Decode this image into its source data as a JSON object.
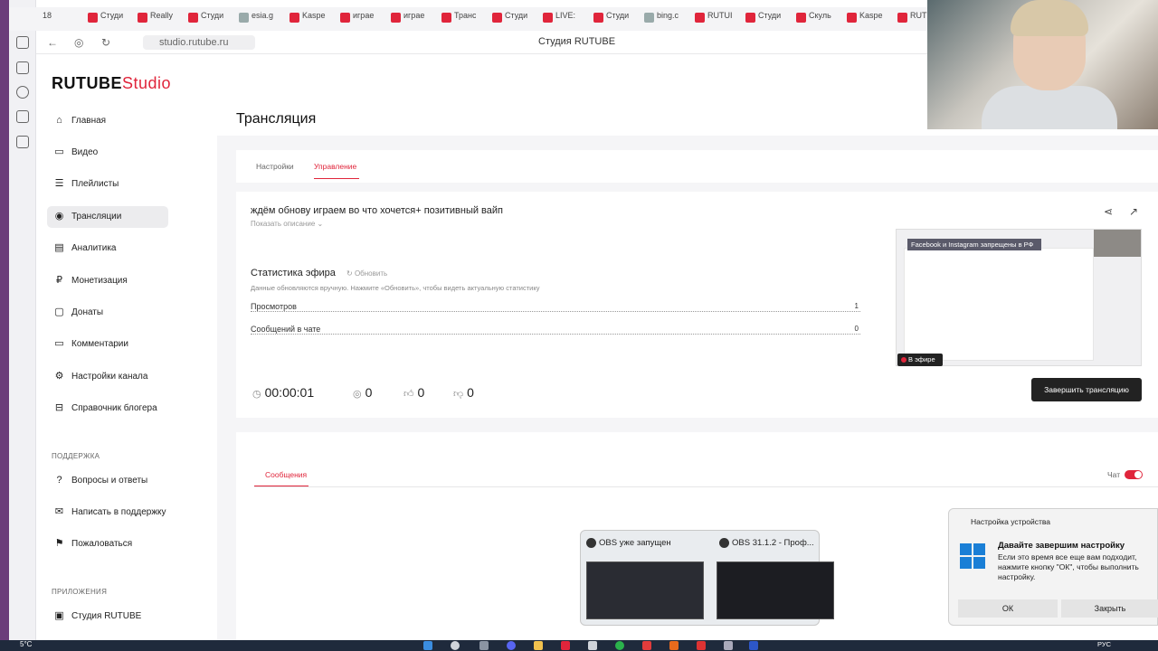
{
  "browser": {
    "tabs": [
      "Студи",
      "Really",
      "Студи",
      "esia.g",
      "Kaspe",
      "играе",
      "играе",
      "Транс",
      "Студи",
      "LIVE:",
      "Студи",
      "bing.c",
      "RUTUI",
      "Студи",
      "Скуль",
      "Kaspe",
      "RUTI"
    ],
    "tab_count_badge": "18",
    "url": "studio.rutube.ru",
    "page_title": "Студия RUTUBE"
  },
  "logo": {
    "brand": "RUTUBE",
    "studio": "Studio"
  },
  "sidebar": {
    "items": [
      {
        "label": "Главная",
        "icon": "home-icon"
      },
      {
        "label": "Видео",
        "icon": "video-icon"
      },
      {
        "label": "Плейлисты",
        "icon": "playlist-icon"
      },
      {
        "label": "Трансляции",
        "icon": "broadcast-icon"
      },
      {
        "label": "Аналитика",
        "icon": "analytics-icon"
      },
      {
        "label": "Монетизация",
        "icon": "monetization-icon"
      },
      {
        "label": "Донаты",
        "icon": "donations-icon"
      },
      {
        "label": "Комментарии",
        "icon": "comments-icon"
      },
      {
        "label": "Настройки канала",
        "icon": "gear-icon"
      },
      {
        "label": "Справочник блогера",
        "icon": "book-icon"
      }
    ],
    "support_header": "ПОДДЕРЖКА",
    "support_items": [
      {
        "label": "Вопросы и ответы",
        "icon": "question-icon"
      },
      {
        "label": "Написать в поддержку",
        "icon": "mail-icon"
      },
      {
        "label": "Пожаловаться",
        "icon": "flag-icon"
      }
    ],
    "apps_header": "ПРИЛОЖЕНИЯ",
    "apps_items": [
      {
        "label": "Студия RUTUBE",
        "icon": "studio-app-icon"
      }
    ]
  },
  "main": {
    "title": "Трансляция",
    "tabs": [
      {
        "label": "Настройки"
      },
      {
        "label": "Управление"
      }
    ],
    "stream_title": "ждём обнову играем во что хочется+ позитивный вайп",
    "show_description": "Показать описание",
    "stats": {
      "title": "Статистика эфира",
      "refresh": "Обновить",
      "note": "Данные обновляются вручную. Нажмите «Обновить», чтобы видеть актуальную статистику",
      "rows": [
        {
          "label": "Просмотров",
          "value": "1"
        },
        {
          "label": "Сообщений в чате",
          "value": "0"
        }
      ]
    },
    "metrics": {
      "duration": "00:00:01",
      "viewers": "0",
      "likes": "0",
      "dislikes": "0"
    },
    "preview": {
      "banner": "Facebook и Instagram запрещены в РФ",
      "live_badge": "В эфире"
    },
    "end_stream_button": "Завершить трансляцию",
    "messages_tab": "Сообщения",
    "chat_label": "Чат",
    "chat_enabled": true
  },
  "obs_popup": {
    "left_title": "OBS уже запущен",
    "right_title": "OBS 31.1.2 - Проф..."
  },
  "notification": {
    "header": "Настройка устройства",
    "title": "Давайте завершим настройку",
    "body": "Если это время все еще вам подходит, нажмите кнопку \"ОК\", чтобы выполнить настройку.",
    "ok_button": "ОК",
    "close_button": "Закрыть"
  },
  "taskbar": {
    "weather": "5°C",
    "lang": "РУС"
  },
  "colors": {
    "accent": "#e0253b",
    "dark_button": "#222222"
  }
}
